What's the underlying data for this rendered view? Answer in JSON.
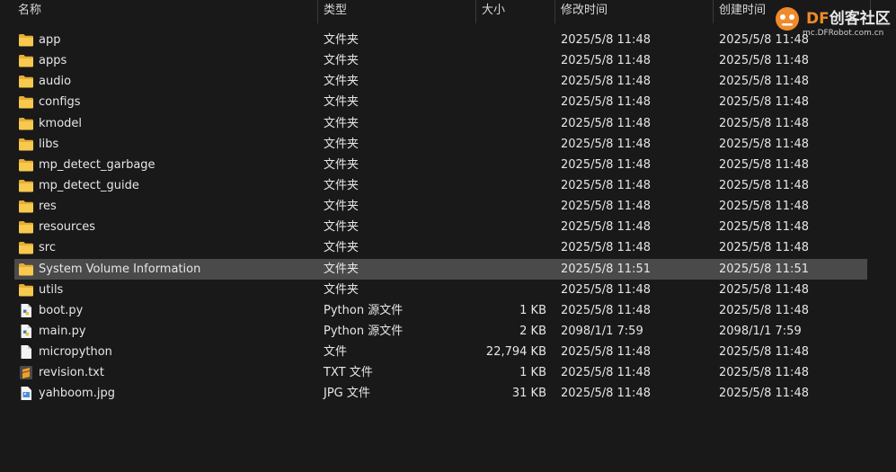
{
  "columns": {
    "name": "名称",
    "type": "类型",
    "size": "大小",
    "modified": "修改时间",
    "created": "创建时间"
  },
  "files": [
    {
      "name": "app",
      "type": "文件夹",
      "size": "",
      "modified": "2025/5/8 11:48",
      "created": "2025/5/8 11:48",
      "icon": "folder-icon"
    },
    {
      "name": "apps",
      "type": "文件夹",
      "size": "",
      "modified": "2025/5/8 11:48",
      "created": "2025/5/8 11:48",
      "icon": "folder-icon"
    },
    {
      "name": "audio",
      "type": "文件夹",
      "size": "",
      "modified": "2025/5/8 11:48",
      "created": "2025/5/8 11:48",
      "icon": "folder-icon"
    },
    {
      "name": "configs",
      "type": "文件夹",
      "size": "",
      "modified": "2025/5/8 11:48",
      "created": "2025/5/8 11:48",
      "icon": "folder-icon"
    },
    {
      "name": "kmodel",
      "type": "文件夹",
      "size": "",
      "modified": "2025/5/8 11:48",
      "created": "2025/5/8 11:48",
      "icon": "folder-icon"
    },
    {
      "name": "libs",
      "type": "文件夹",
      "size": "",
      "modified": "2025/5/8 11:48",
      "created": "2025/5/8 11:48",
      "icon": "folder-icon"
    },
    {
      "name": "mp_detect_garbage",
      "type": "文件夹",
      "size": "",
      "modified": "2025/5/8 11:48",
      "created": "2025/5/8 11:48",
      "icon": "folder-icon"
    },
    {
      "name": "mp_detect_guide",
      "type": "文件夹",
      "size": "",
      "modified": "2025/5/8 11:48",
      "created": "2025/5/8 11:48",
      "icon": "folder-icon"
    },
    {
      "name": "res",
      "type": "文件夹",
      "size": "",
      "modified": "2025/5/8 11:48",
      "created": "2025/5/8 11:48",
      "icon": "folder-icon"
    },
    {
      "name": "resources",
      "type": "文件夹",
      "size": "",
      "modified": "2025/5/8 11:48",
      "created": "2025/5/8 11:48",
      "icon": "folder-icon"
    },
    {
      "name": "src",
      "type": "文件夹",
      "size": "",
      "modified": "2025/5/8 11:48",
      "created": "2025/5/8 11:48",
      "icon": "folder-icon"
    },
    {
      "name": "System Volume Information",
      "type": "文件夹",
      "size": "",
      "modified": "2025/5/8 11:51",
      "created": "2025/5/8 11:51",
      "icon": "folder-icon",
      "selected": true
    },
    {
      "name": "utils",
      "type": "文件夹",
      "size": "",
      "modified": "2025/5/8 11:48",
      "created": "2025/5/8 11:48",
      "icon": "folder-icon"
    },
    {
      "name": "boot.py",
      "type": "Python 源文件",
      "size": "1 KB",
      "modified": "2025/5/8 11:48",
      "created": "2025/5/8 11:48",
      "icon": "python-file-icon"
    },
    {
      "name": "main.py",
      "type": "Python 源文件",
      "size": "2 KB",
      "modified": "2098/1/1 7:59",
      "created": "2098/1/1 7:59",
      "icon": "python-file-icon"
    },
    {
      "name": "micropython",
      "type": "文件",
      "size": "22,794 KB",
      "modified": "2025/5/8 11:48",
      "created": "2025/5/8 11:48",
      "icon": "blank-file-icon"
    },
    {
      "name": "revision.txt",
      "type": "TXT 文件",
      "size": "1 KB",
      "modified": "2025/5/8 11:48",
      "created": "2025/5/8 11:48",
      "icon": "sublime-text-file-icon"
    },
    {
      "name": "yahboom.jpg",
      "type": "JPG 文件",
      "size": "31 KB",
      "modified": "2025/5/8 11:48",
      "created": "2025/5/8 11:48",
      "icon": "image-file-icon"
    }
  ],
  "watermark": {
    "brand_prefix": "DF",
    "brand_suffix": "创客社区",
    "url": "mc.DFRobot.com.cn"
  },
  "colors": {
    "background": "#191919",
    "selected_row": "#4a4a4a",
    "folder": "#f2c14e",
    "brand_orange": "#f08a2a"
  }
}
